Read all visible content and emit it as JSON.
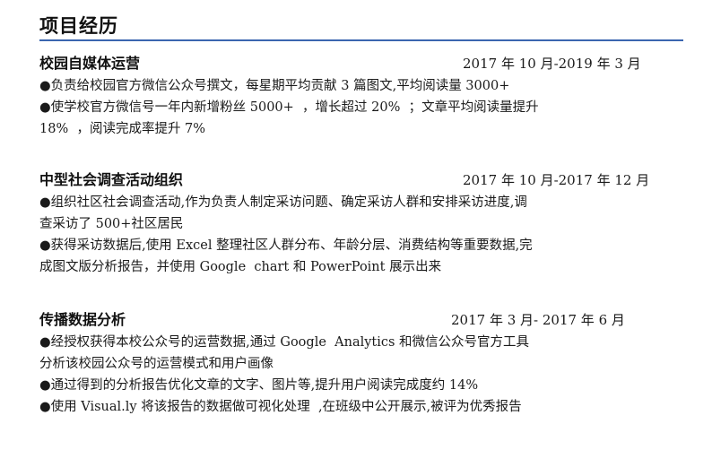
{
  "section": {
    "title": "项目经历"
  },
  "projects": [
    {
      "name": "校园自媒体运营",
      "date": "2017 年 10 月-2019 年 3 月",
      "bullets": [
        "●负责给校园官方微信公众号撰文，每星期平均贡献 3 篇图文,平均阅读量 3000+",
        "●使学校官方微信号一年内新增粉丝 5000+  ，增长超过 20%  ；文章平均阅读量提升\n18%  ，阅读完成率提升 7%"
      ]
    },
    {
      "name": "中型社会调查活动组织",
      "date": "2017 年 10 月-2017 年 12 月",
      "bullets": [
        "●组织社区社会调查活动,作为负责人制定采访问题、确定采访人群和安排采访进度,调\n查采访了 500+社区居民",
        "●获得采访数据后,使用 Excel 整理社区人群分布、年龄分层、消费结构等重要数据,完\n成图文版分析报告，并使用 Google  chart 和 PowerPoint 展示出来"
      ]
    },
    {
      "name": "传播数据分析",
      "date": "2017 年 3 月-  2017 年 6 月",
      "bullets": [
        "●经授权获得本校公众号的运营数据,通过 Google  Analytics 和微信公众号官方工具\n分析该校园公众号的运营模式和用户画像",
        "●通过得到的分析报告优化文章的文字、图片等,提升用户阅读完成度约 14%",
        "●使用 Visual.ly 将该报告的数据做可视化处理  ,在班级中公开展示,被评为优秀报告"
      ]
    }
  ]
}
